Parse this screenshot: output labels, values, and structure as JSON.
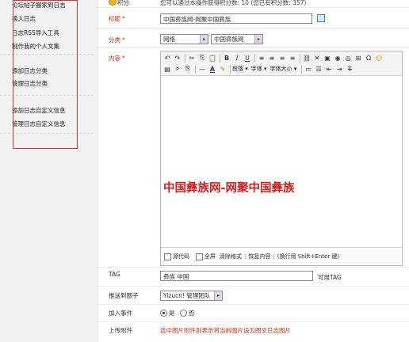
{
  "sidebar": {
    "group1": [
      "论坛帖子搬家到日志",
      "换入日志",
      "日志RSS导入工具",
      "制作我的个人文集"
    ],
    "group2": [
      "添加日志分类",
      "管理日志分类"
    ],
    "group3": [
      "添加日志自定义信息",
      "管理日志自定义信息"
    ]
  },
  "header": {
    "points_label": "积分",
    "points_hint": "您可以通过本操作获得积分数: 10 (您已有积分数: 357)"
  },
  "form": {
    "title_label": "标题",
    "title_value": "中国彝族网-网聚中国彝族",
    "category_label": "分类",
    "category_select1": "网络",
    "category_select2": "中国彝族网",
    "content_label": "内容",
    "required_mark": "*",
    "tag_label": "TAG",
    "tag_value": "彝族 中国",
    "tag_link": "可用TAG",
    "push_label": "推送到圈子",
    "push_value": "Yizucn! 管理团队",
    "event_label": "加入事件",
    "event_yes": "是",
    "event_no": "否",
    "upload_label": "上传附件",
    "upload_hint": "选中图片附件则表示将当前图片设为图文日志图片"
  },
  "editor": {
    "content_text": "中国彝族网-网聚中国彝族",
    "toolbar_row1_icons": [
      "undo-icon",
      "redo-icon",
      "cut-icon",
      "copy-icon",
      "paste-icon",
      "bold-icon",
      "italic-icon",
      "underline-icon",
      "align-left-icon",
      "align-center-icon",
      "align-right-icon",
      "justify-icon",
      "link-icon",
      "unlink-icon",
      "image-icon",
      "flash-icon",
      "media-icon",
      "table-icon",
      "special-icon",
      "smiley-icon"
    ],
    "toolbar_row2": {
      "paragraph": "段落",
      "font": "字体",
      "font_size": "字体大小"
    },
    "footer": {
      "source_code": "源代码",
      "fullscreen": "全屏",
      "clear_format": "清除格式",
      "restore": "恢复内容",
      "linebreak_hint": "(换行用 Shift+Enter 键)"
    }
  },
  "colors": {
    "label_red": "#c31",
    "content_red": "#d41e1e",
    "outline_red": "#d33"
  }
}
